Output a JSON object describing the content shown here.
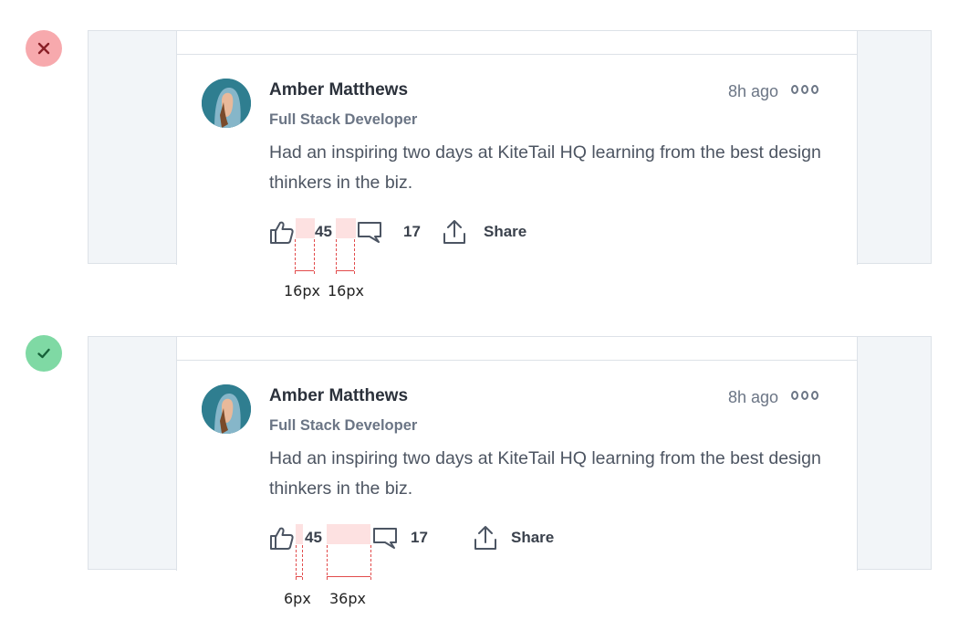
{
  "examples": [
    {
      "status": "incorrect",
      "status_icon": "x-icon",
      "status_color": "#f7a9ad",
      "post": {
        "name": "Amber Matthews",
        "role": "Full Stack Developer",
        "time": "8h ago",
        "body": "Had an inspiring two days at KiteTail HQ learning from the best design thinkers in the biz.",
        "likes": "45",
        "comments": "17",
        "share_label": "Share"
      },
      "measurements": [
        "16px",
        "16px"
      ]
    },
    {
      "status": "correct",
      "status_icon": "check-icon",
      "status_color": "#7fd9a4",
      "post": {
        "name": "Amber Matthews",
        "role": "Full Stack Developer",
        "time": "8h ago",
        "body": "Had an inspiring two days at KiteTail HQ learning from the best design thinkers in the biz.",
        "likes": "45",
        "comments": "17",
        "share_label": "Share"
      },
      "measurements": [
        "6px",
        "36px"
      ]
    }
  ],
  "colors": {
    "gap_highlight": "#fde1e1",
    "measure_line": "#e24b4b"
  }
}
